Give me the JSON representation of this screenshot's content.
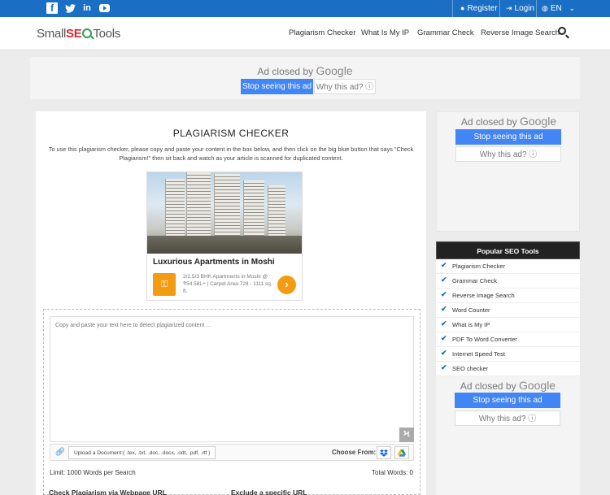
{
  "topbar": {
    "social": [
      "f",
      "t",
      "in",
      "youtube"
    ],
    "register": "Register",
    "login": "Login",
    "language": "EN",
    "colors": {
      "bar": "#1a6fc4"
    }
  },
  "header": {
    "logo": {
      "part1": "Small",
      "part2": "SE",
      "part3": "Tools"
    },
    "nav": [
      "Plagiarism Checker",
      "What Is My IP",
      "Grammar Check",
      "Reverse Image Search"
    ],
    "search_icon": "search-icon"
  },
  "ad_top": {
    "closed_prefix": "Ad closed by",
    "google": "Google",
    "stop": "Stop seeing this ad",
    "why": "Why this ad? ⓘ"
  },
  "main": {
    "title": "PLAGIARISM CHECKER",
    "description": "To use this plagiarism checker, please copy and paste your content in the box below, and then click on the big blue button that says \"Check Plagiarism!\" then sit back and watch as your article is scanned for duplicated content.",
    "native_ad": {
      "title": "Luxurious Apartments in Moshi",
      "subtitle": "2/2.5/3 BHK Apartments in Moshi @ ₹54.58L+ | Carpet Area 728 - 1111 sq. ft.",
      "go": "›"
    },
    "textarea_placeholder": "Copy and paste your text here to detect plagiarized content ...",
    "upload_label": "Upload a Document:( .tex, .txt, .doc, .docx, .odt, .pdf, .rtf )",
    "choose_from": "Choose From:",
    "limit": "Limit: 1000 Words per Search",
    "total": "Total Words: 0",
    "check_url": "Check Plagiarism via Webpage URL",
    "exclude_url": "Exclude a specific URL"
  },
  "sidebar": {
    "ad1": {
      "closed_prefix": "Ad closed by",
      "google": "Google",
      "stop": "Stop seeing this ad",
      "why": "Why this ad? ⓘ"
    },
    "tools_title": "Popular SEO Tools",
    "tools": [
      "Plagiarism Checker",
      "Grammar Check",
      "Reverse Image Search",
      "Word Counter",
      "What is My IP",
      "PDF To Word Converter",
      "Internet Speed Test",
      "SEO checker"
    ],
    "ad2": {
      "closed_prefix": "Ad closed by",
      "google": "Google",
      "stop": "Stop seeing this ad",
      "why": "Why this ad? ⓘ"
    }
  }
}
